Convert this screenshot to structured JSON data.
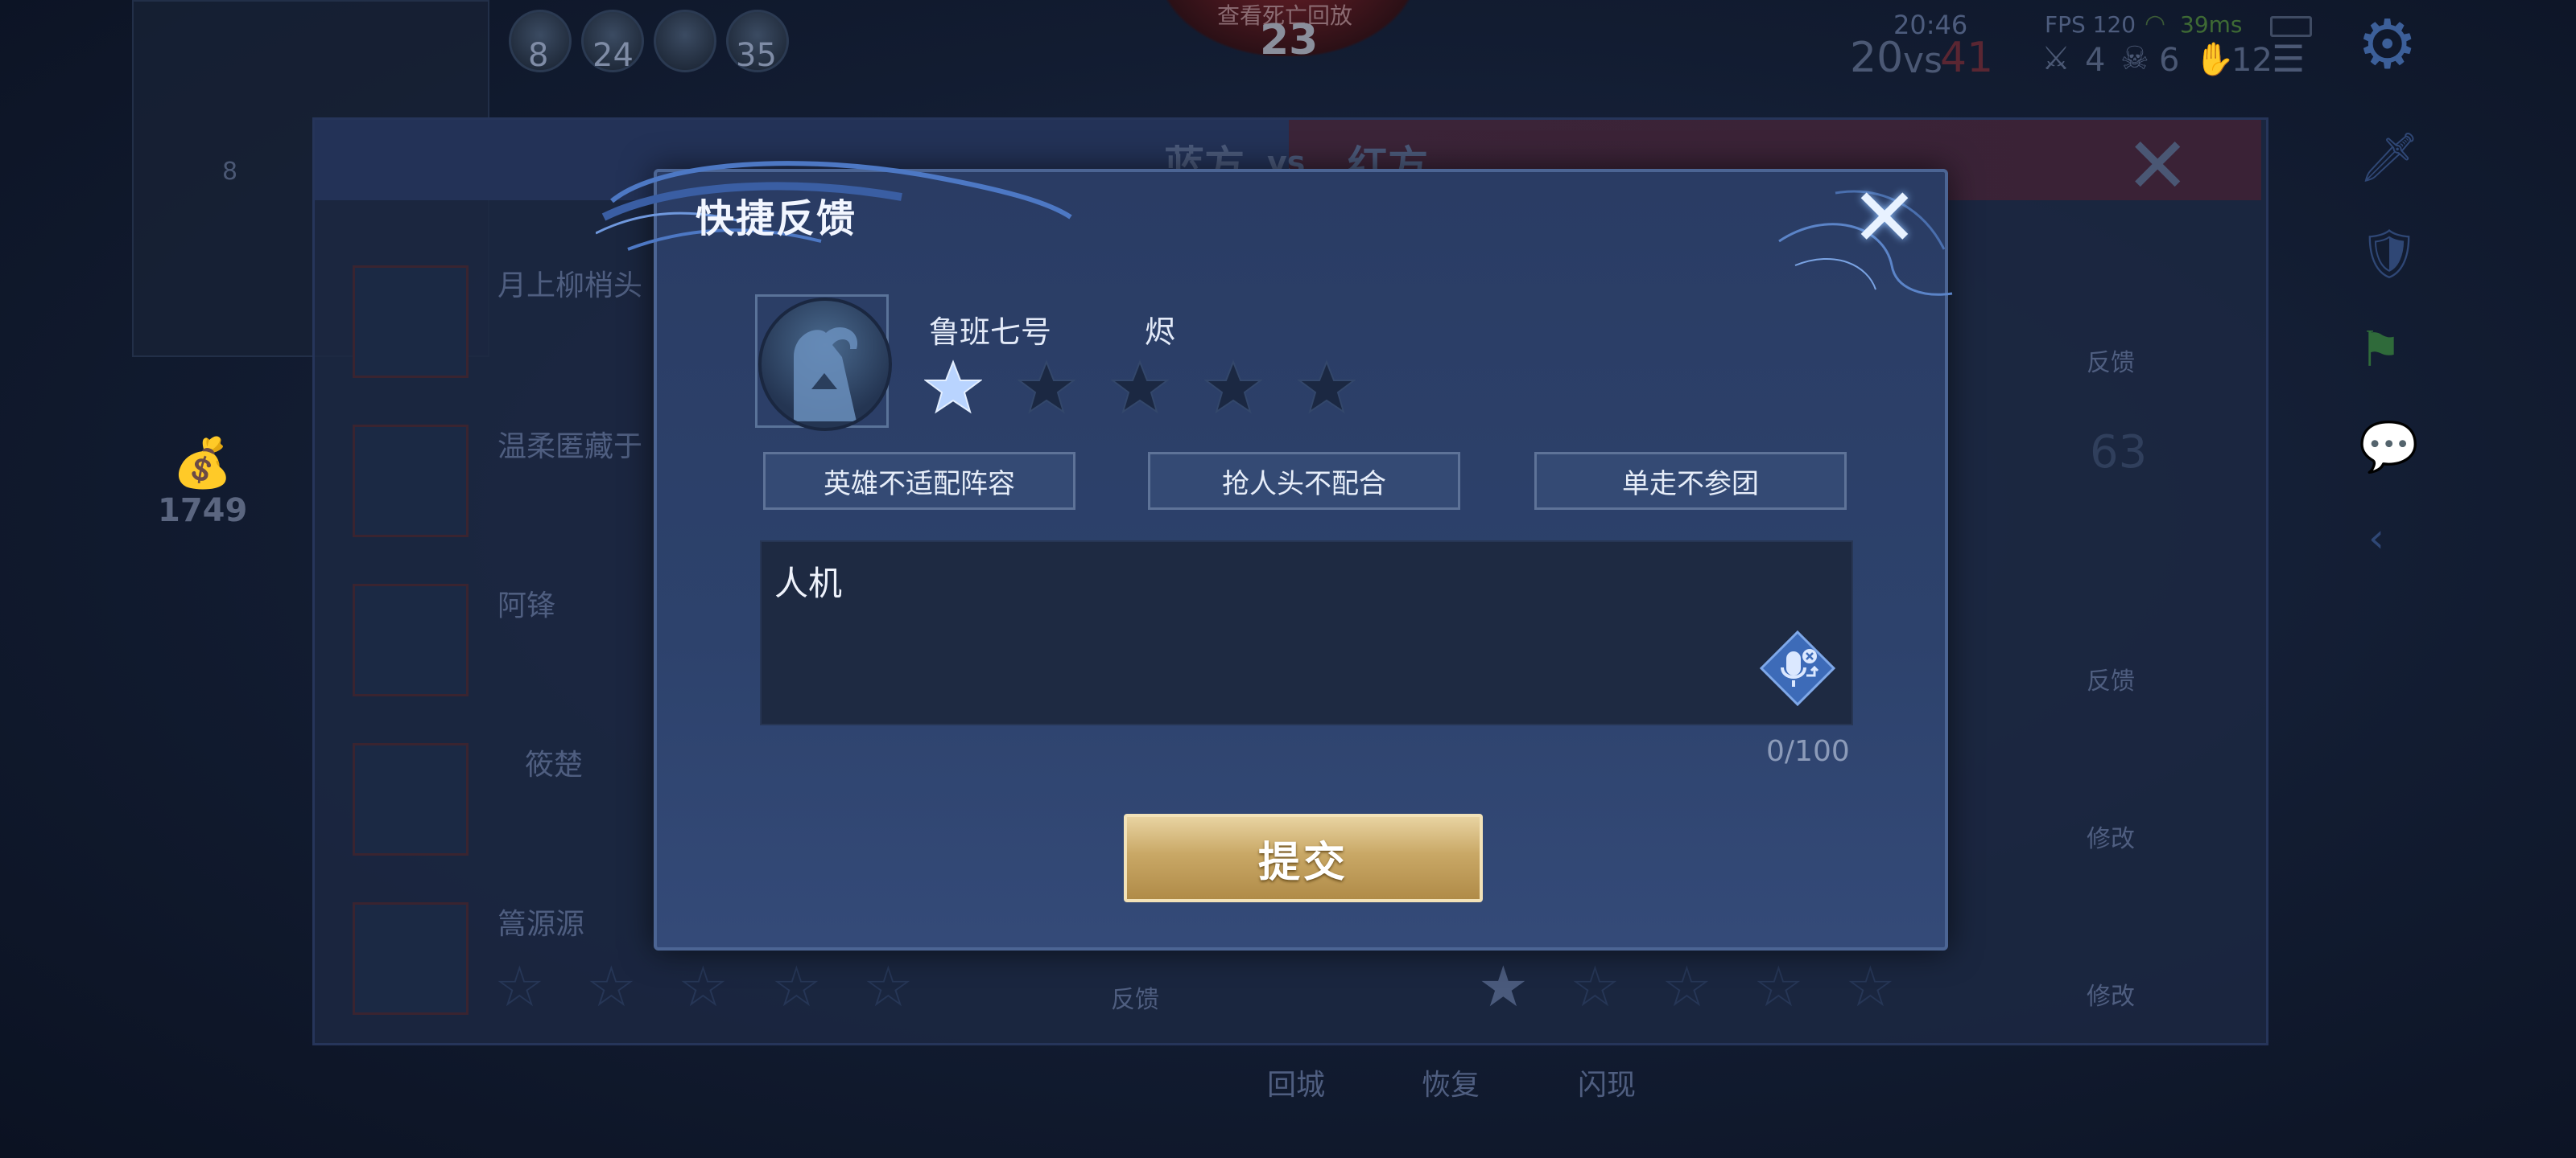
{
  "hud": {
    "kills_top": [
      "8",
      "24",
      "",
      "35"
    ],
    "center_label": "查看死亡回放",
    "center_value": "23",
    "time": "20:46",
    "fps": "FPS 120",
    "ping": "39ms",
    "score_blue": "20",
    "score_vs": "vs",
    "score_red": "41",
    "stat_kills": "4",
    "stat_deaths": "6",
    "stat_assists": "12",
    "gold": "1749",
    "left_small_num": "8"
  },
  "background": {
    "blue_team": "蓝方",
    "vs": "vs",
    "red_team": "红方",
    "rows": [
      {
        "name": "月上柳梢头"
      },
      {
        "name": "温柔匿藏于"
      },
      {
        "name": "阿锋"
      },
      {
        "name": "筱楚"
      },
      {
        "name": "篙源源"
      }
    ],
    "side_labels": [
      "反馈",
      "反馈",
      "修改",
      "修改"
    ],
    "center_feedback": "反馈",
    "skill_labels": [
      "回城",
      "恢复",
      "闪现"
    ],
    "bg_number": "63"
  },
  "dialog": {
    "title": "快捷反馈",
    "player_name": "鲁班七号",
    "hero_name": "烬",
    "rating": 1,
    "rating_max": 5,
    "tags": [
      "英雄不适配阵容",
      "抢人头不配合",
      "单走不参团"
    ],
    "input_value": "人机",
    "counter": "0/100",
    "submit_label": "提交"
  },
  "colors": {
    "dialog_bg": "#2d426c",
    "star_active": "#b9d4ff",
    "star_inactive": "#1b2842",
    "submit_gold": "#c9a866",
    "accent_red": "#b33b48"
  },
  "icons": {
    "close": "close-icon",
    "mic": "voice-input-icon",
    "settings": "gear-icon"
  }
}
